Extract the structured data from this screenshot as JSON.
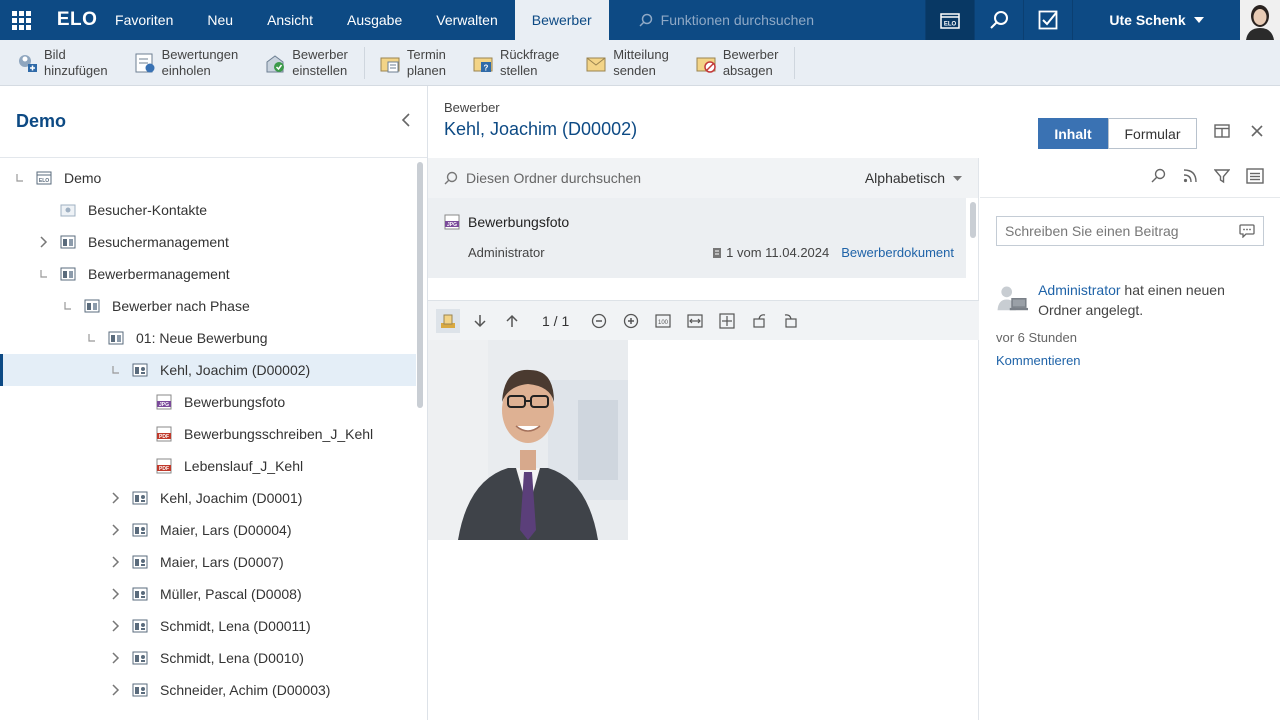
{
  "topbar": {
    "logo": "ELO",
    "nav": [
      "Favoriten",
      "Neu",
      "Ansicht",
      "Ausgabe",
      "Verwalten",
      "Bewerber"
    ],
    "active_nav": "Bewerber",
    "search_placeholder": "Funktionen durchsuchen",
    "user_name": "Ute Schenk"
  },
  "ribbon": {
    "buttons": [
      {
        "label": "Bild\nhinzufügen",
        "icon": "add-image-icon"
      },
      {
        "label": "Bewertungen\neinholen",
        "icon": "rating-icon"
      },
      {
        "label": "Bewerber\neinstellen",
        "icon": "hire-icon"
      },
      {
        "label": "Termin\nplanen",
        "icon": "calendar-icon"
      },
      {
        "label": "Rückfrage\nstellen",
        "icon": "question-icon"
      },
      {
        "label": "Mitteilung\nsenden",
        "icon": "send-message-icon"
      },
      {
        "label": "Bewerber\nabsagen",
        "icon": "reject-icon"
      }
    ]
  },
  "left": {
    "title": "Demo",
    "tree": [
      {
        "label": "Demo",
        "indent": 0,
        "toggle": "end",
        "icon": "archive-icon"
      },
      {
        "label": "Besucher-Kontakte",
        "indent": 1,
        "toggle": "none",
        "icon": "contacts-icon"
      },
      {
        "label": "Besuchermanagement",
        "indent": 1,
        "toggle": "collapsed",
        "icon": "folder-icon"
      },
      {
        "label": "Bewerbermanagement",
        "indent": 1,
        "toggle": "end",
        "icon": "folder-icon"
      },
      {
        "label": "Bewerber nach Phase",
        "indent": 2,
        "toggle": "end",
        "icon": "folder-icon"
      },
      {
        "label": "01: Neue Bewerbung",
        "indent": 3,
        "toggle": "end",
        "icon": "folder-icon"
      },
      {
        "label": "Kehl, Joachim (D00002)",
        "indent": 4,
        "toggle": "end",
        "icon": "applicant-icon",
        "selected": true
      },
      {
        "label": "Bewerbungsfoto",
        "indent": 5,
        "toggle": "none",
        "icon": "jpg-icon"
      },
      {
        "label": "Bewerbungsschreiben_J_Kehl",
        "indent": 5,
        "toggle": "none",
        "icon": "pdf-icon"
      },
      {
        "label": "Lebenslauf_J_Kehl",
        "indent": 5,
        "toggle": "none",
        "icon": "pdf-icon"
      },
      {
        "label": "Kehl, Joachim (D0001)",
        "indent": 4,
        "toggle": "collapsed",
        "icon": "applicant-icon"
      },
      {
        "label": "Maier, Lars (D00004)",
        "indent": 4,
        "toggle": "collapsed",
        "icon": "applicant-icon"
      },
      {
        "label": "Maier, Lars (D0007)",
        "indent": 4,
        "toggle": "collapsed",
        "icon": "applicant-icon"
      },
      {
        "label": "Müller, Pascal (D0008)",
        "indent": 4,
        "toggle": "collapsed",
        "icon": "applicant-icon"
      },
      {
        "label": "Schmidt, Lena (D00011)",
        "indent": 4,
        "toggle": "collapsed",
        "icon": "applicant-icon"
      },
      {
        "label": "Schmidt, Lena (D0010)",
        "indent": 4,
        "toggle": "collapsed",
        "icon": "applicant-icon"
      },
      {
        "label": "Schneider, Achim (D00003)",
        "indent": 4,
        "toggle": "collapsed",
        "icon": "applicant-icon"
      }
    ]
  },
  "main": {
    "crumb": "Bewerber",
    "title": "Kehl, Joachim (D00002)",
    "tab_content": "Inhalt",
    "tab_form": "Formular",
    "search_placeholder": "Diesen Ordner durchsuchen",
    "sort_label": "Alphabetisch",
    "item": {
      "name": "Bewerbungsfoto",
      "owner": "Administrator",
      "version": "1 vom 11.04.2024",
      "doc_type": "Bewerberdokument"
    },
    "viewer": {
      "page": "1 / 1"
    }
  },
  "feed": {
    "post_placeholder": "Schreiben Sie einen Beitrag",
    "entry_user": "Administrator",
    "entry_text": " hat einen neuen Ordner angelegt.",
    "entry_time": "vor 6 Stunden",
    "comment_label": "Kommentieren"
  },
  "colors": {
    "brand": "#0d4a84",
    "accent": "#3a72b3",
    "link": "#1f63a8"
  }
}
